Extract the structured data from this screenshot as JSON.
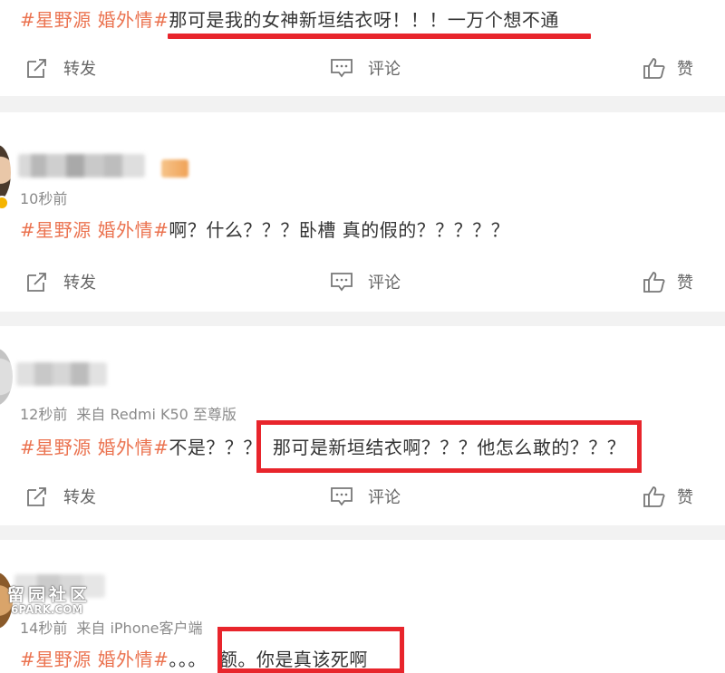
{
  "hashtag": "#星野源 婚外情#",
  "actions": {
    "repost": "转发",
    "comment": "评论",
    "like": "赞"
  },
  "posts": [
    {
      "content": "那可是我的女神新垣结衣呀！！！一万个想不通"
    },
    {
      "time": "10秒前",
      "content": "啊？什么？？？卧槽 真的假的？？？？？"
    },
    {
      "time": "12秒前",
      "source": "来自 Redmi K50 至尊版",
      "content_plain": "不是？？？",
      "content_highlight": "那可是新垣结衣啊？？？他怎么敢的？？？"
    },
    {
      "time": "14秒前",
      "source": "来自 iPhone客户端",
      "content_plain": "。。。",
      "content_highlight": "额。你是真该死啊"
    }
  ],
  "watermark": {
    "line1": "留园社区",
    "line2": "6PARK.COM"
  },
  "colors": {
    "hashtag": "#eb7350",
    "annotation_red": "#e8252c",
    "separator": "#f2f2f2",
    "meta_text": "#8a8a8a"
  }
}
